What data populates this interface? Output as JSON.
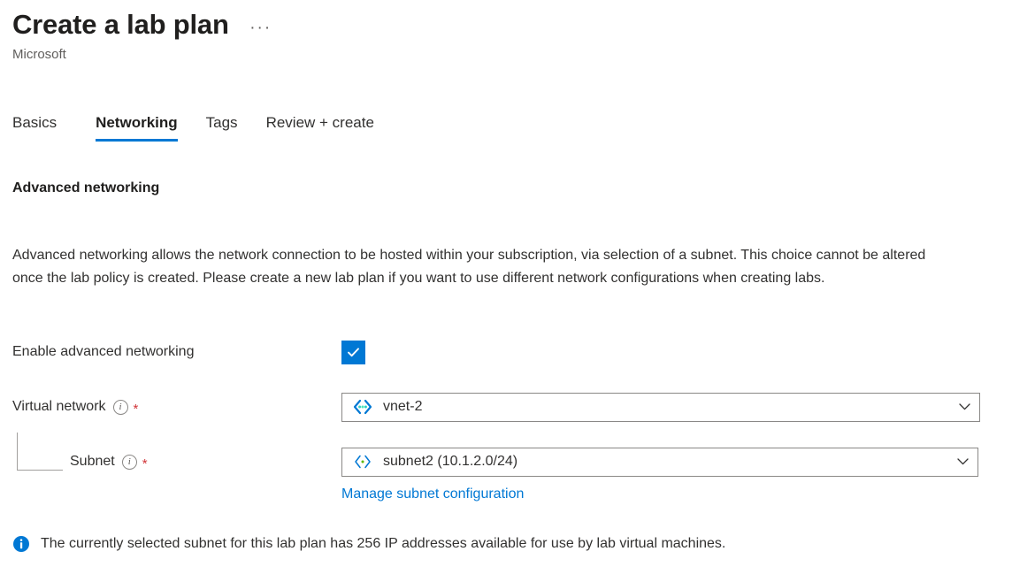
{
  "header": {
    "title": "Create a lab plan",
    "subtitle": "Microsoft",
    "more_label": "···"
  },
  "tabs": [
    {
      "label": "Basics",
      "active": false
    },
    {
      "label": "Networking",
      "active": true
    },
    {
      "label": "Tags",
      "active": false
    },
    {
      "label": "Review + create",
      "active": false
    }
  ],
  "main": {
    "section_heading": "Advanced networking",
    "description": "Advanced networking allows the network connection to be hosted within your subscription, via selection of a subnet. This choice cannot be altered once the lab policy is created. Please create a new lab plan if you want to use different network configurations when creating labs.",
    "enable_advanced_networking": {
      "label": "Enable advanced networking",
      "checked": true,
      "icon": "checkmark-icon"
    },
    "virtual_network": {
      "label": "Virtual network",
      "info_icon": "info-icon",
      "required_marker": "*",
      "value": "vnet-2",
      "resource_icon": "virtual-network-icon",
      "chevron_icon": "chevron-down-icon"
    },
    "subnet": {
      "label": "Subnet",
      "info_icon": "info-icon",
      "required_marker": "*",
      "value": "subnet2 (10.1.2.0/24)",
      "resource_icon": "subnet-icon",
      "chevron_icon": "chevron-down-icon"
    },
    "manage_subnet_link": "Manage subnet configuration",
    "info_message": {
      "icon": "info-filled-icon",
      "text": "The currently selected subnet for this lab plan has 256 IP addresses available for use by lab virtual machines."
    }
  },
  "colors": {
    "accent": "#0078d4",
    "required": "#d13438",
    "text": "#323130",
    "subtle_text": "#605e5c",
    "border": "#8a8886"
  }
}
